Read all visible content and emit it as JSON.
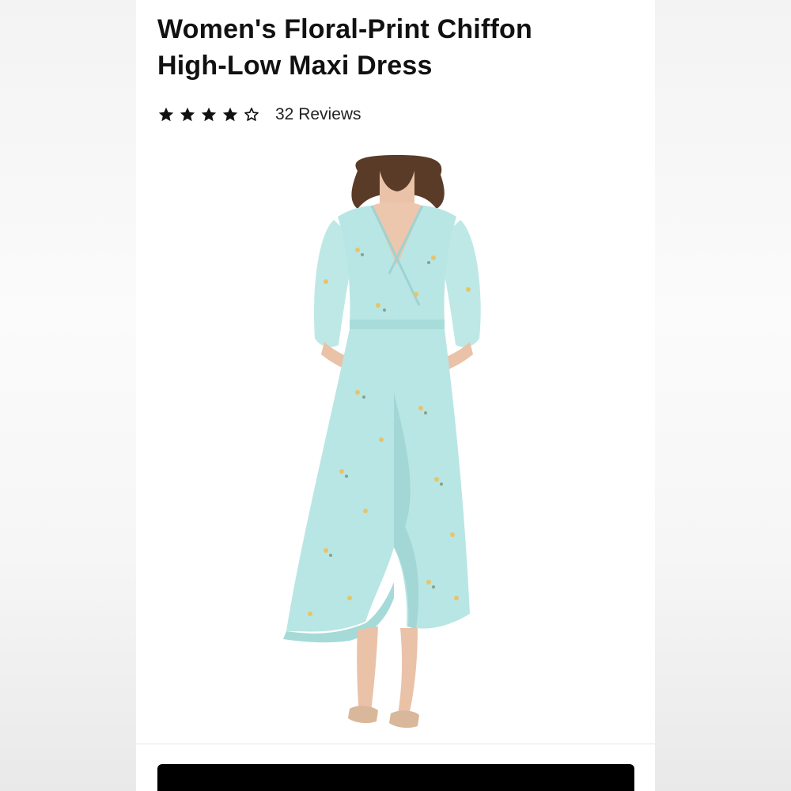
{
  "product": {
    "title_line1": "Women's Floral-Print Chiffon",
    "title_line2": "High-Low Maxi Dress",
    "rating_value": 4,
    "rating_max": 5,
    "reviews_label": "32 Reviews"
  },
  "image": {
    "subject": "model wearing light aqua floral chiffon high-low maxi dress",
    "dress_color": "#b8e6e4",
    "dress_shadow": "#9dd3d2",
    "flower_color": "#e7c46a",
    "leaf_color": "#8aa08a",
    "hair_color": "#5a3b28",
    "skin_color": "#e9c2a8",
    "sandal_color": "#d9b79a"
  },
  "colors": {
    "text": "#111111",
    "cta_background": "#000000"
  }
}
